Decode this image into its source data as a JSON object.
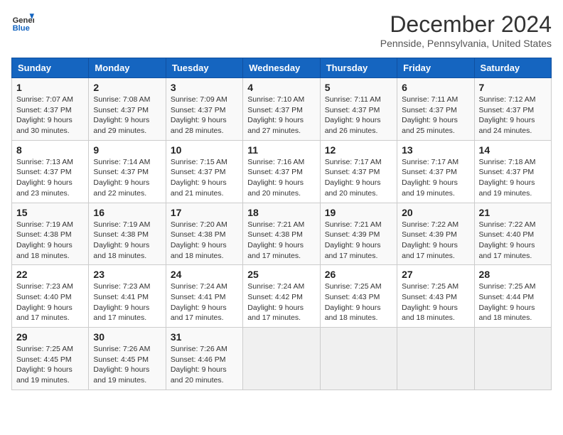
{
  "header": {
    "logo_line1": "General",
    "logo_line2": "Blue",
    "month_title": "December 2024",
    "location": "Pennside, Pennsylvania, United States"
  },
  "days_of_week": [
    "Sunday",
    "Monday",
    "Tuesday",
    "Wednesday",
    "Thursday",
    "Friday",
    "Saturday"
  ],
  "weeks": [
    [
      {
        "day": "1",
        "sunrise": "Sunrise: 7:07 AM",
        "sunset": "Sunset: 4:37 PM",
        "daylight": "Daylight: 9 hours and 30 minutes."
      },
      {
        "day": "2",
        "sunrise": "Sunrise: 7:08 AM",
        "sunset": "Sunset: 4:37 PM",
        "daylight": "Daylight: 9 hours and 29 minutes."
      },
      {
        "day": "3",
        "sunrise": "Sunrise: 7:09 AM",
        "sunset": "Sunset: 4:37 PM",
        "daylight": "Daylight: 9 hours and 28 minutes."
      },
      {
        "day": "4",
        "sunrise": "Sunrise: 7:10 AM",
        "sunset": "Sunset: 4:37 PM",
        "daylight": "Daylight: 9 hours and 27 minutes."
      },
      {
        "day": "5",
        "sunrise": "Sunrise: 7:11 AM",
        "sunset": "Sunset: 4:37 PM",
        "daylight": "Daylight: 9 hours and 26 minutes."
      },
      {
        "day": "6",
        "sunrise": "Sunrise: 7:11 AM",
        "sunset": "Sunset: 4:37 PM",
        "daylight": "Daylight: 9 hours and 25 minutes."
      },
      {
        "day": "7",
        "sunrise": "Sunrise: 7:12 AM",
        "sunset": "Sunset: 4:37 PM",
        "daylight": "Daylight: 9 hours and 24 minutes."
      }
    ],
    [
      {
        "day": "8",
        "sunrise": "Sunrise: 7:13 AM",
        "sunset": "Sunset: 4:37 PM",
        "daylight": "Daylight: 9 hours and 23 minutes."
      },
      {
        "day": "9",
        "sunrise": "Sunrise: 7:14 AM",
        "sunset": "Sunset: 4:37 PM",
        "daylight": "Daylight: 9 hours and 22 minutes."
      },
      {
        "day": "10",
        "sunrise": "Sunrise: 7:15 AM",
        "sunset": "Sunset: 4:37 PM",
        "daylight": "Daylight: 9 hours and 21 minutes."
      },
      {
        "day": "11",
        "sunrise": "Sunrise: 7:16 AM",
        "sunset": "Sunset: 4:37 PM",
        "daylight": "Daylight: 9 hours and 20 minutes."
      },
      {
        "day": "12",
        "sunrise": "Sunrise: 7:17 AM",
        "sunset": "Sunset: 4:37 PM",
        "daylight": "Daylight: 9 hours and 20 minutes."
      },
      {
        "day": "13",
        "sunrise": "Sunrise: 7:17 AM",
        "sunset": "Sunset: 4:37 PM",
        "daylight": "Daylight: 9 hours and 19 minutes."
      },
      {
        "day": "14",
        "sunrise": "Sunrise: 7:18 AM",
        "sunset": "Sunset: 4:37 PM",
        "daylight": "Daylight: 9 hours and 19 minutes."
      }
    ],
    [
      {
        "day": "15",
        "sunrise": "Sunrise: 7:19 AM",
        "sunset": "Sunset: 4:38 PM",
        "daylight": "Daylight: 9 hours and 18 minutes."
      },
      {
        "day": "16",
        "sunrise": "Sunrise: 7:19 AM",
        "sunset": "Sunset: 4:38 PM",
        "daylight": "Daylight: 9 hours and 18 minutes."
      },
      {
        "day": "17",
        "sunrise": "Sunrise: 7:20 AM",
        "sunset": "Sunset: 4:38 PM",
        "daylight": "Daylight: 9 hours and 18 minutes."
      },
      {
        "day": "18",
        "sunrise": "Sunrise: 7:21 AM",
        "sunset": "Sunset: 4:38 PM",
        "daylight": "Daylight: 9 hours and 17 minutes."
      },
      {
        "day": "19",
        "sunrise": "Sunrise: 7:21 AM",
        "sunset": "Sunset: 4:39 PM",
        "daylight": "Daylight: 9 hours and 17 minutes."
      },
      {
        "day": "20",
        "sunrise": "Sunrise: 7:22 AM",
        "sunset": "Sunset: 4:39 PM",
        "daylight": "Daylight: 9 hours and 17 minutes."
      },
      {
        "day": "21",
        "sunrise": "Sunrise: 7:22 AM",
        "sunset": "Sunset: 4:40 PM",
        "daylight": "Daylight: 9 hours and 17 minutes."
      }
    ],
    [
      {
        "day": "22",
        "sunrise": "Sunrise: 7:23 AM",
        "sunset": "Sunset: 4:40 PM",
        "daylight": "Daylight: 9 hours and 17 minutes."
      },
      {
        "day": "23",
        "sunrise": "Sunrise: 7:23 AM",
        "sunset": "Sunset: 4:41 PM",
        "daylight": "Daylight: 9 hours and 17 minutes."
      },
      {
        "day": "24",
        "sunrise": "Sunrise: 7:24 AM",
        "sunset": "Sunset: 4:41 PM",
        "daylight": "Daylight: 9 hours and 17 minutes."
      },
      {
        "day": "25",
        "sunrise": "Sunrise: 7:24 AM",
        "sunset": "Sunset: 4:42 PM",
        "daylight": "Daylight: 9 hours and 17 minutes."
      },
      {
        "day": "26",
        "sunrise": "Sunrise: 7:25 AM",
        "sunset": "Sunset: 4:43 PM",
        "daylight": "Daylight: 9 hours and 18 minutes."
      },
      {
        "day": "27",
        "sunrise": "Sunrise: 7:25 AM",
        "sunset": "Sunset: 4:43 PM",
        "daylight": "Daylight: 9 hours and 18 minutes."
      },
      {
        "day": "28",
        "sunrise": "Sunrise: 7:25 AM",
        "sunset": "Sunset: 4:44 PM",
        "daylight": "Daylight: 9 hours and 18 minutes."
      }
    ],
    [
      {
        "day": "29",
        "sunrise": "Sunrise: 7:25 AM",
        "sunset": "Sunset: 4:45 PM",
        "daylight": "Daylight: 9 hours and 19 minutes."
      },
      {
        "day": "30",
        "sunrise": "Sunrise: 7:26 AM",
        "sunset": "Sunset: 4:45 PM",
        "daylight": "Daylight: 9 hours and 19 minutes."
      },
      {
        "day": "31",
        "sunrise": "Sunrise: 7:26 AM",
        "sunset": "Sunset: 4:46 PM",
        "daylight": "Daylight: 9 hours and 20 minutes."
      },
      null,
      null,
      null,
      null
    ]
  ]
}
